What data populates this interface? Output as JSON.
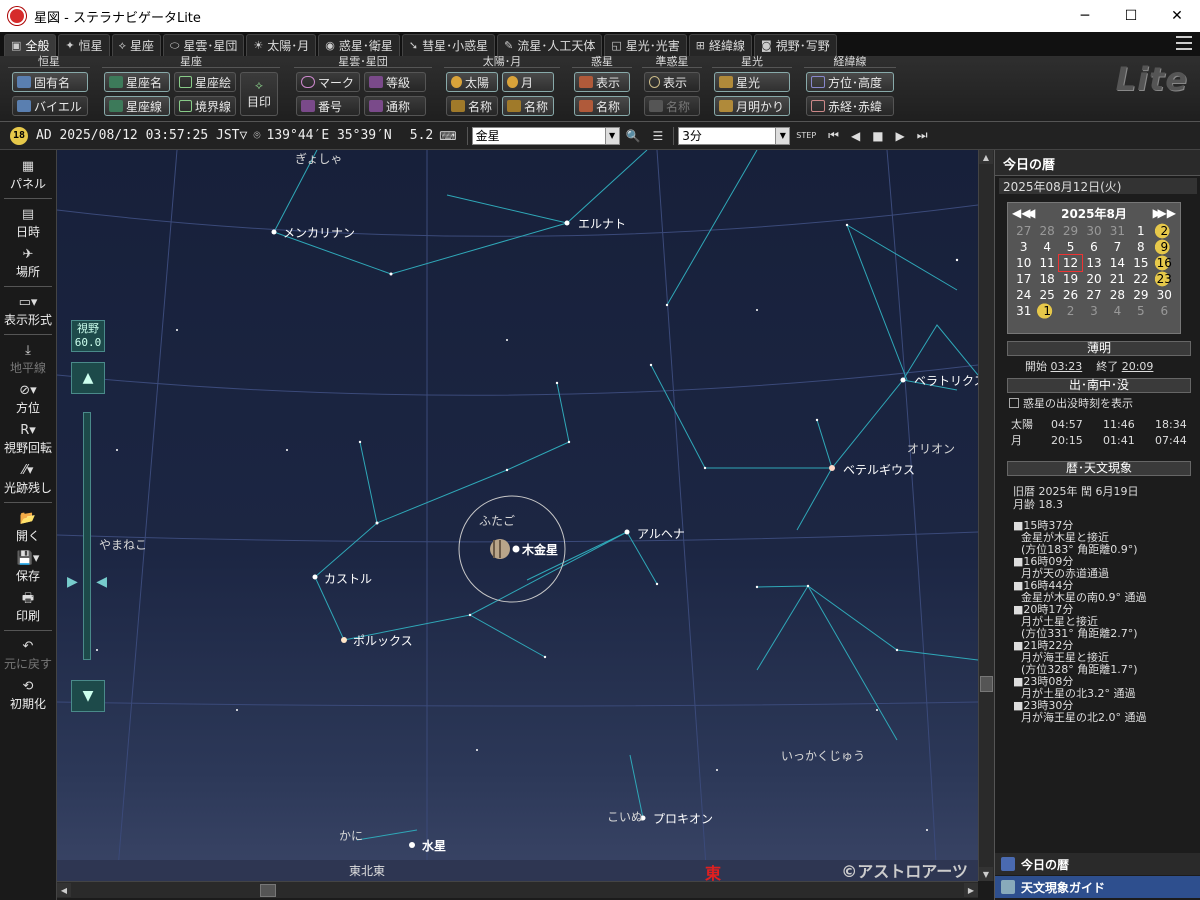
{
  "window": {
    "title": "星図 - ステラナビゲータLite",
    "minimize": "─",
    "maximize": "☐",
    "close": "✕"
  },
  "tabs": [
    {
      "label": "全般",
      "icon": "▣"
    },
    {
      "label": "恒星",
      "icon": "✦"
    },
    {
      "label": "星座",
      "icon": "⟡"
    },
    {
      "label": "星雲･星団",
      "icon": "⬭"
    },
    {
      "label": "太陽･月",
      "icon": "☀"
    },
    {
      "label": "惑星･衛星",
      "icon": "◉"
    },
    {
      "label": "彗星･小惑星",
      "icon": "➘"
    },
    {
      "label": "流星･人工天体",
      "icon": "✎"
    },
    {
      "label": "星光･光害",
      "icon": "◱"
    },
    {
      "label": "経緯線",
      "icon": "⊞"
    },
    {
      "label": "視野･写野",
      "icon": "◙"
    }
  ],
  "ribbon": {
    "groups": {
      "stars": "恒星",
      "constellations": "星座",
      "nebulae": "星雲･星団",
      "sunmoon": "太陽･月",
      "planets": "惑星",
      "dwarf": "準惑星",
      "starlight": "星光",
      "grid": "経緯線"
    },
    "buttons": {
      "proper_name": "固有名",
      "bayer": "バイエル",
      "const_name": "星座名",
      "const_art": "星座絵",
      "const_line": "星座線",
      "boundary": "境界線",
      "marker": "目印",
      "mark": "マーク",
      "magnitude": "等級",
      "number": "番号",
      "common_name": "通称",
      "sun": "太陽",
      "moon": "月",
      "sm_name": "名称",
      "moon_name": "名称",
      "pl_show": "表示",
      "pl_name": "名称",
      "dw_show": "表示",
      "dw_name": "名称",
      "starlight": "星光",
      "moonlight": "月明かり",
      "altaz": "方位･高度",
      "radec": "赤経･赤緯"
    },
    "logo": "Lite"
  },
  "status": {
    "badge": "18",
    "datetime": "AD 2025/08/12 03:57:25 JST▽",
    "location": "139°44′E 35°39′N",
    "magnitude": "5.2",
    "search_value": "金星",
    "step_value": "3分",
    "step_label": "STEP"
  },
  "leftbar": [
    {
      "label": "パネル",
      "icon": "▦"
    },
    {
      "label": "日時",
      "icon": "▤"
    },
    {
      "label": "場所",
      "icon": "✈"
    },
    {
      "label": "表示形式",
      "icon": "▭▾"
    },
    {
      "label": "地平線",
      "icon": "⤓"
    },
    {
      "label": "方位",
      "icon": "⊘▾"
    },
    {
      "label": "視野回転",
      "icon": "R▾"
    },
    {
      "label": "光跡残し",
      "icon": "⁄⁄▾"
    },
    {
      "label": "開く",
      "icon": "📂"
    },
    {
      "label": "保存",
      "icon": "💾▾"
    },
    {
      "label": "印刷",
      "icon": "🖶"
    },
    {
      "label": "元に戻す",
      "icon": "↶"
    },
    {
      "label": "初期化",
      "icon": "⟲"
    }
  ],
  "map": {
    "fov_label": "視野",
    "fov_value": "60.0",
    "zoom_in": "▲",
    "zoom_out": "▼",
    "stars": {
      "menkalinan": "メンカリナン",
      "elnath": "エルナト",
      "bellatrix": "ベラトリクス",
      "betelgeuse": "ベテルギウス",
      "alhena": "アルヘナ",
      "castor": "カストル",
      "pollux": "ポルックス",
      "procyon": "プロキオン"
    },
    "planets": {
      "jupiter_venus": "木金星",
      "mercury": "水星"
    },
    "constellations": {
      "auriga": "ぎょしゃ",
      "lynx": "やまねこ",
      "gemini": "ふたご",
      "orion": "オリオン",
      "monoceros": "いっかくじゅう",
      "canis_minor": "こいぬ",
      "cancer": "かに"
    },
    "horizon": {
      "northeast": "東北東",
      "east": "東"
    },
    "copyright": "©アストロアーツ"
  },
  "panel": {
    "title": "今日の暦",
    "date": "2025年08月12日(火)",
    "calendar": {
      "month": "2025年8月",
      "days": [
        "27",
        "28",
        "29",
        "30",
        "31",
        "1",
        "2",
        "3",
        "4",
        "5",
        "6",
        "7",
        "8",
        "9",
        "10",
        "11",
        "12",
        "13",
        "14",
        "15",
        "16",
        "17",
        "18",
        "19",
        "20",
        "21",
        "22",
        "23",
        "24",
        "25",
        "26",
        "27",
        "28",
        "29",
        "30",
        "31",
        "1",
        "2",
        "3",
        "4",
        "5",
        "6"
      ]
    },
    "twilight": {
      "head": "薄明",
      "start_label": "開始",
      "start": "03:23",
      "end_label": "終了",
      "end": "20:09"
    },
    "rise": {
      "head": "出･南中･没",
      "checkbox": "惑星の出没時刻を表示",
      "sun": {
        "name": "太陽",
        "rise": "04:57",
        "transit": "11:46",
        "set": "18:34"
      },
      "moon": {
        "name": "月",
        "rise": "20:15",
        "transit": "01:41",
        "set": "07:44"
      }
    },
    "events": {
      "head": "暦･天文現象",
      "lunar": "旧暦 2025年 閏 6月19日",
      "age": "月齢 18.3",
      "lines": [
        "■15時37分",
        "金星が木星と接近",
        "(方位183° 角距離0.9°)",
        "■16時09分",
        "月が天の赤道通過",
        "■16時44分",
        "金星が木星の南0.9° 通過",
        "■20時17分",
        "月が土星と接近",
        "(方位331° 角距離2.7°)",
        "■21時22分",
        "月が海王星と接近",
        "(方位328° 角距離1.7°)",
        "■23時08分",
        "月が土星の北3.2° 通過",
        "■23時30分",
        "月が海王星の北2.0° 通過"
      ]
    },
    "bottom1": "今日の暦",
    "bottom2": "天文現象ガイド"
  }
}
